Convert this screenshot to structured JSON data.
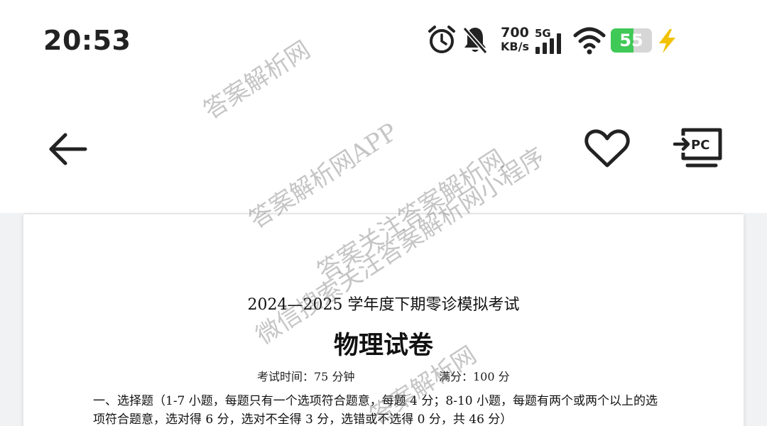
{
  "status_bar": {
    "time": "20:53",
    "net_speed_value": "700",
    "net_speed_unit": "KB/s",
    "network_type": "5G",
    "battery_level": "55",
    "battery_fraction": 0.55,
    "icons": [
      "alarm-icon",
      "bell-muted-icon",
      "signal-icon",
      "wifi-icon",
      "battery-icon",
      "charging-bolt-icon"
    ],
    "colors": {
      "battery": "#3fc956",
      "bolt": "#f2c200"
    }
  },
  "top_nav": {
    "icons": [
      "back-arrow-icon",
      "heart-icon",
      "cast-to-pc-icon"
    ],
    "pc_label": "PC"
  },
  "document": {
    "title": "2024—2025 学年度下期零诊模拟考试",
    "subject": "物理试卷",
    "exam_time": "考试时间：75 分钟",
    "full_score": "满分：100 分",
    "section_lines": [
      "一、选择题（1-7 小题，每题只有一个选项符合题意，每题 4 分；8-10 小题，每题有两个或两个以上的选",
      "项符合题意，选对得 6 分，选对不全得 3 分，选错或不选得 0 分，共 46 分）"
    ]
  },
  "watermarks": [
    "答案解析网",
    "答案解析网APP",
    "答案关注答案解析网",
    "微信搜索关注答案解析网小程序",
    "答案解析网"
  ]
}
